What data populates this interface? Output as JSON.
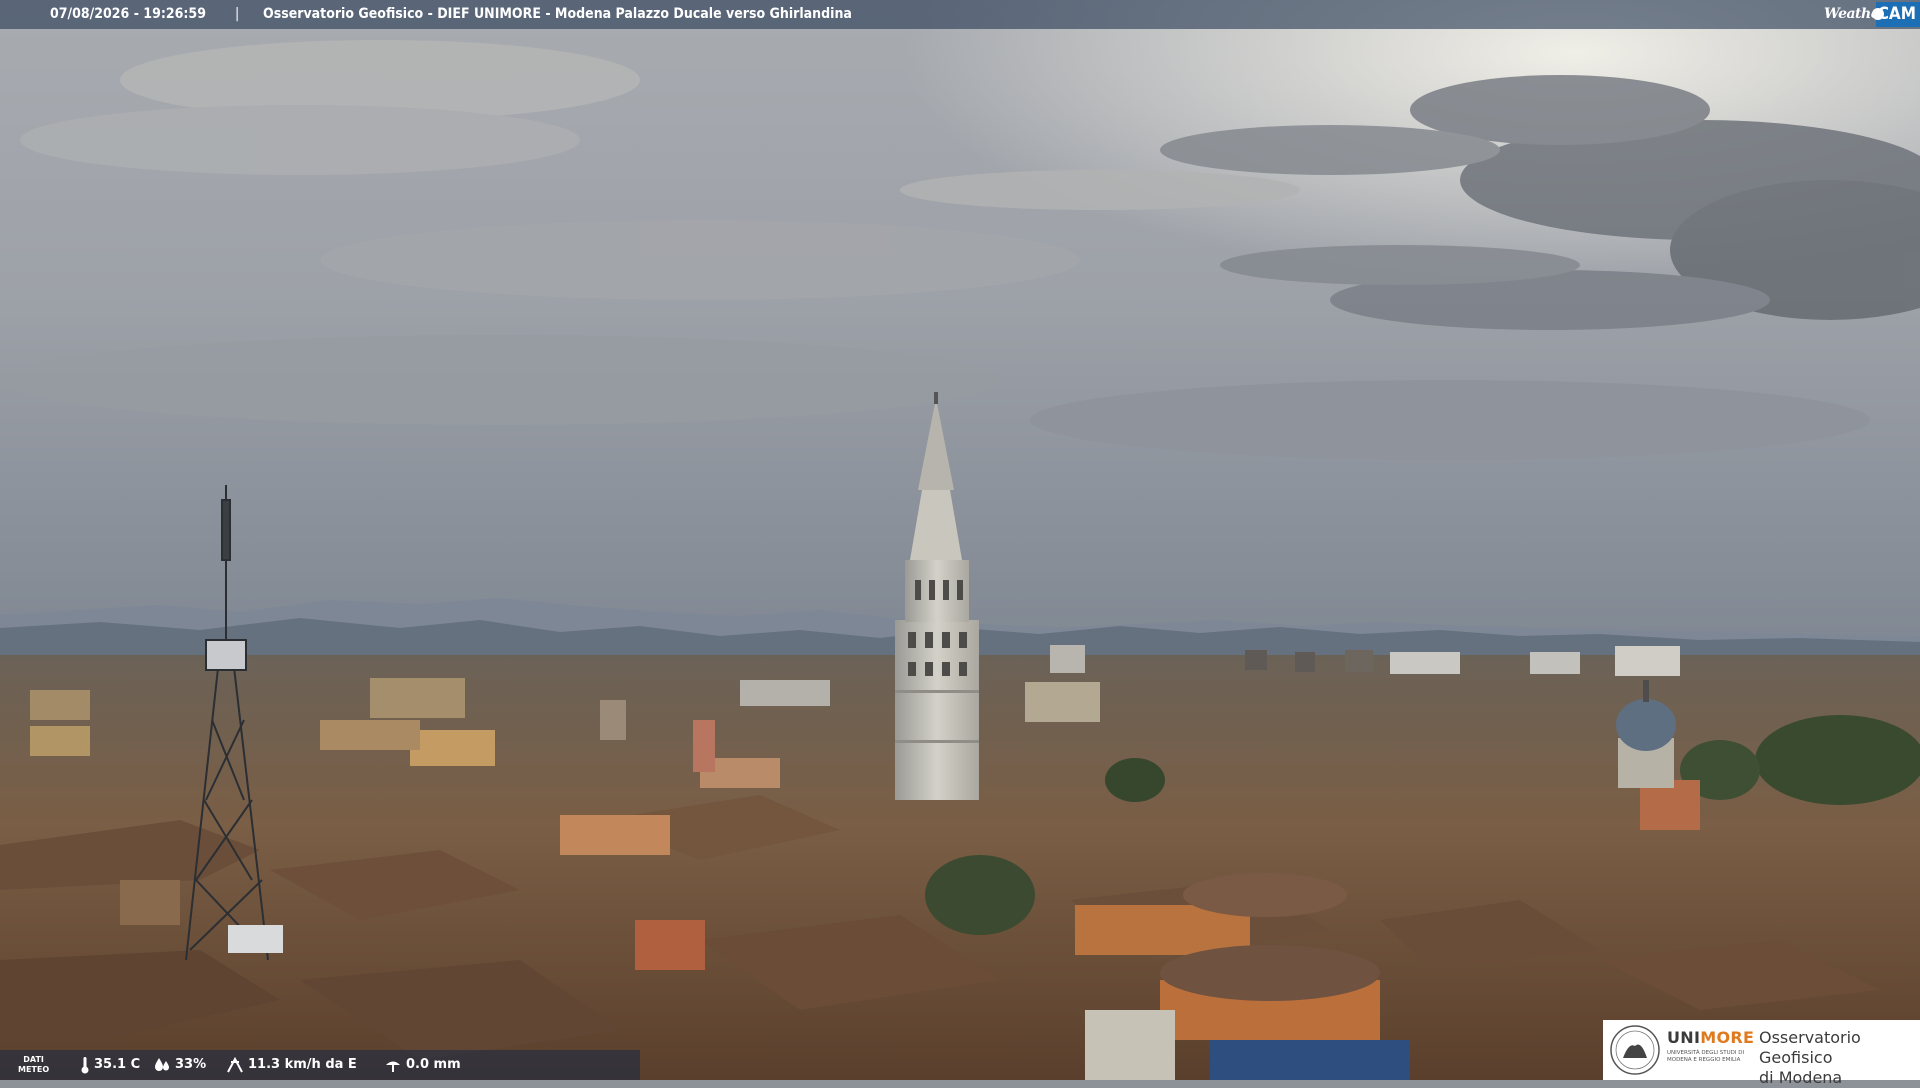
{
  "overlay": {
    "timestamp": "07/08/2026 - 19:26:59",
    "separator": "|",
    "title": "Osservatorio Geofisico - DIEF UNIMORE - Modena Palazzo Ducale verso Ghirlandina",
    "brand_weather": "Weather",
    "brand_cam": "CAM"
  },
  "weather_bar": {
    "label_line1": "DATI",
    "label_line2": "METEO",
    "temperature": "35.1 C",
    "humidity": "33%",
    "wind": "11.3 km/h da E",
    "rain": "0.0 mm"
  },
  "logo": {
    "uni_prefix": "UNI",
    "uni_suffix": "MORE",
    "uni_sub1": "UNIVERSITÀ DEGLI STUDI DI",
    "uni_sub2": "MODENA E REGGIO EMILIA",
    "observatory_line1": "Osservatorio Geofisico",
    "observatory_line2": "di Modena"
  },
  "colors": {
    "overlay_bar": "#2a3c56",
    "brand_blue": "#1d6fb5",
    "unimore_orange": "#e07a1e"
  }
}
